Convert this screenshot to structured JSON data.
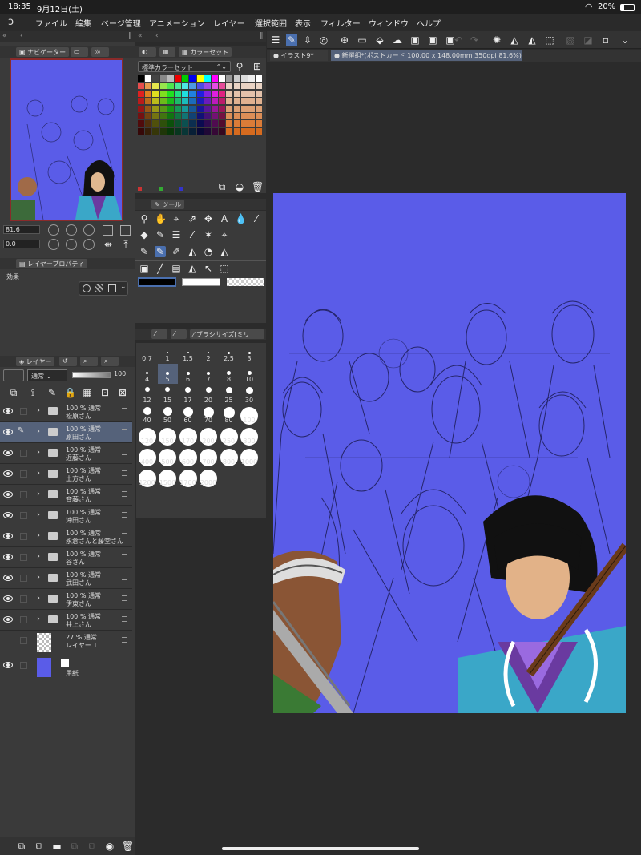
{
  "status": {
    "time": "18:35",
    "date": "9月12日(土)",
    "battery": "20%"
  },
  "menu": [
    "ファイル",
    "編集",
    "ページ管理",
    "アニメーション",
    "レイヤー",
    "選択範囲",
    "表示",
    "フィルター",
    "ウィンドウ",
    "ヘルプ"
  ],
  "doc_tabs": {
    "tab1": "イラスト9*",
    "tab2": "新撰組*(ポストカード 100.00 x 148.00mm 350dpi 81.6%)"
  },
  "navigator": {
    "title": "ナビゲーター",
    "zoom": "81.6",
    "rotate": "0.0"
  },
  "layer_property": {
    "title": "レイヤープロパティ",
    "effect_label": "効果"
  },
  "color_set": {
    "title": "カラーセット",
    "set_name": "標準カラーセット"
  },
  "tool": {
    "title": "ツール"
  },
  "brush_size": {
    "title": "ブラシサイズ[ミリ",
    "sizes": [
      "0.7",
      "1",
      "1.5",
      "2",
      "2.5",
      "3",
      "4",
      "5",
      "6",
      "7",
      "8",
      "10",
      "12",
      "15",
      "17",
      "20",
      "25",
      "30",
      "40",
      "50",
      "60",
      "70",
      "80",
      "100",
      "120",
      "150",
      "170",
      "200",
      "250",
      "300",
      "400",
      "500",
      "600",
      "700",
      "800",
      "1000",
      "1200",
      "1500",
      "1700",
      "2000"
    ]
  },
  "layers_panel": {
    "title": "レイヤー",
    "blend": "通常",
    "opacity": "100"
  },
  "layers": [
    {
      "opacity": "100 % 通常",
      "name": "松原さん",
      "folder": true,
      "selected": false
    },
    {
      "opacity": "100 % 通常",
      "name": "原田さん",
      "folder": true,
      "selected": true
    },
    {
      "opacity": "100 % 通常",
      "name": "近藤さん",
      "folder": true,
      "selected": false
    },
    {
      "opacity": "100 % 通常",
      "name": "土方さん",
      "folder": true,
      "selected": false
    },
    {
      "opacity": "100 % 通常",
      "name": "斉藤さん",
      "folder": true,
      "selected": false
    },
    {
      "opacity": "100 % 通常",
      "name": "沖田さん",
      "folder": true,
      "selected": false
    },
    {
      "opacity": "100 % 通常",
      "name": "永倉さんと藤堂さん",
      "folder": true,
      "selected": false
    },
    {
      "opacity": "100 % 通常",
      "name": "谷さん",
      "folder": true,
      "selected": false
    },
    {
      "opacity": "100 % 通常",
      "name": "武田さん",
      "folder": true,
      "selected": false
    },
    {
      "opacity": "100 % 通常",
      "name": "伊東さん",
      "folder": true,
      "selected": false
    },
    {
      "opacity": "100 % 通常",
      "name": "井上さん",
      "folder": true,
      "selected": false
    },
    {
      "opacity": "27 % 通常",
      "name": "レイヤー 1",
      "folder": false,
      "selected": false
    },
    {
      "opacity": "",
      "name": "用紙",
      "folder": false,
      "selected": false
    }
  ],
  "colors": {
    "canvas_bg": "#5a5ce8",
    "accent": "#4a6fae",
    "selected_row": "#55627a"
  }
}
